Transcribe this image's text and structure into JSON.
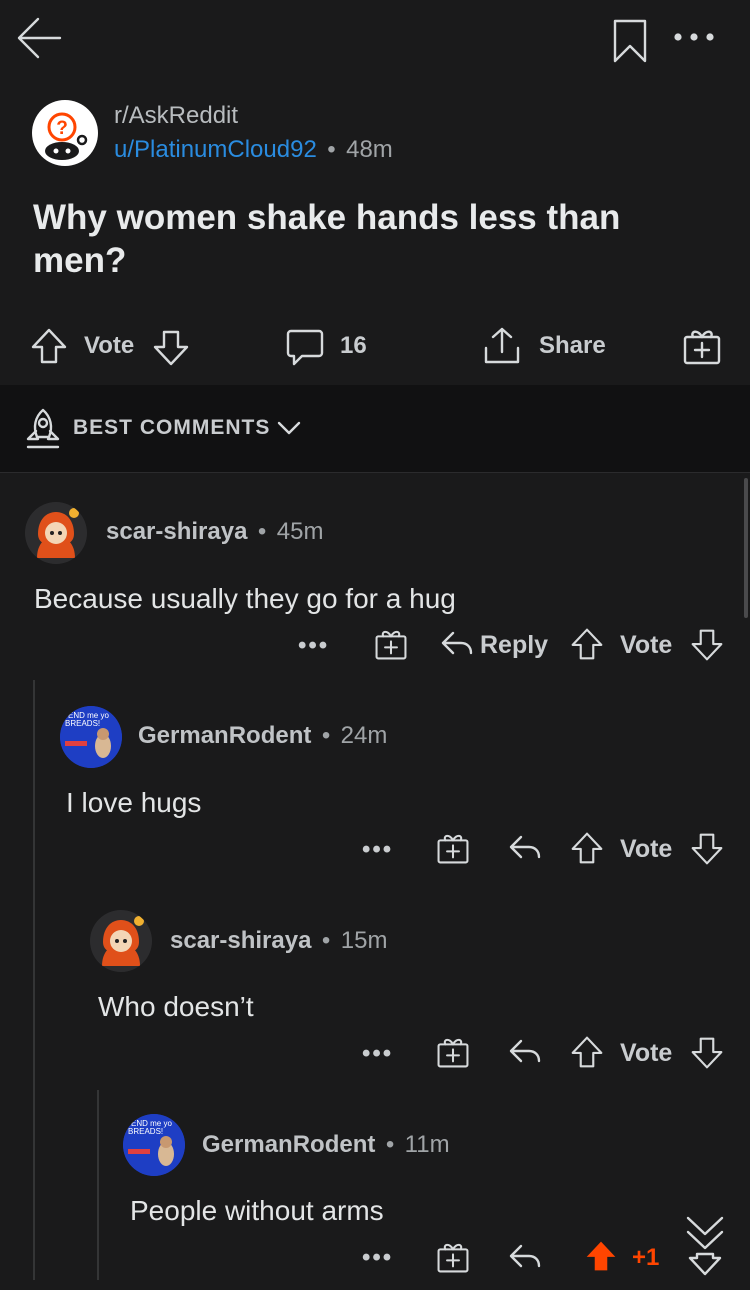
{
  "post": {
    "subreddit": "r/AskReddit",
    "author": "u/PlatinumCloud92",
    "time": "48m",
    "title": "Why women shake hands less than men?",
    "vote_label": "Vote",
    "comment_count": "16",
    "share_label": "Share"
  },
  "sort": {
    "label": "BEST COMMENTS"
  },
  "comments": [
    {
      "user": "scar-shiraya",
      "time": "45m",
      "body": "Because usually they go for a hug",
      "reply_label": "Reply",
      "vote_label": "Vote"
    },
    {
      "user": "GermanRodent",
      "time": "24m",
      "body": "I love hugs",
      "vote_label": "Vote"
    },
    {
      "user": "scar-shiraya",
      "time": "15m",
      "body": "Who doesn’t",
      "vote_label": "Vote"
    },
    {
      "user": "GermanRodent",
      "time": "11m",
      "body": "People without arms",
      "score": "+1"
    }
  ],
  "avatar_text": {
    "line1": "END me yo",
    "line2": "BREADS!"
  },
  "more_dots": "•••",
  "separator": "•",
  "colors": {
    "accent_orange": "#ff4500",
    "link_blue": "#2a8ce0",
    "background": "#1a1a1b"
  },
  "icons": [
    "back-arrow-icon",
    "bookmark-icon",
    "more-icon",
    "upvote-icon",
    "downvote-icon",
    "comment-icon",
    "share-icon",
    "award-icon",
    "rocket-icon",
    "chevron-down-icon",
    "reply-icon",
    "collapse-down-icon"
  ]
}
